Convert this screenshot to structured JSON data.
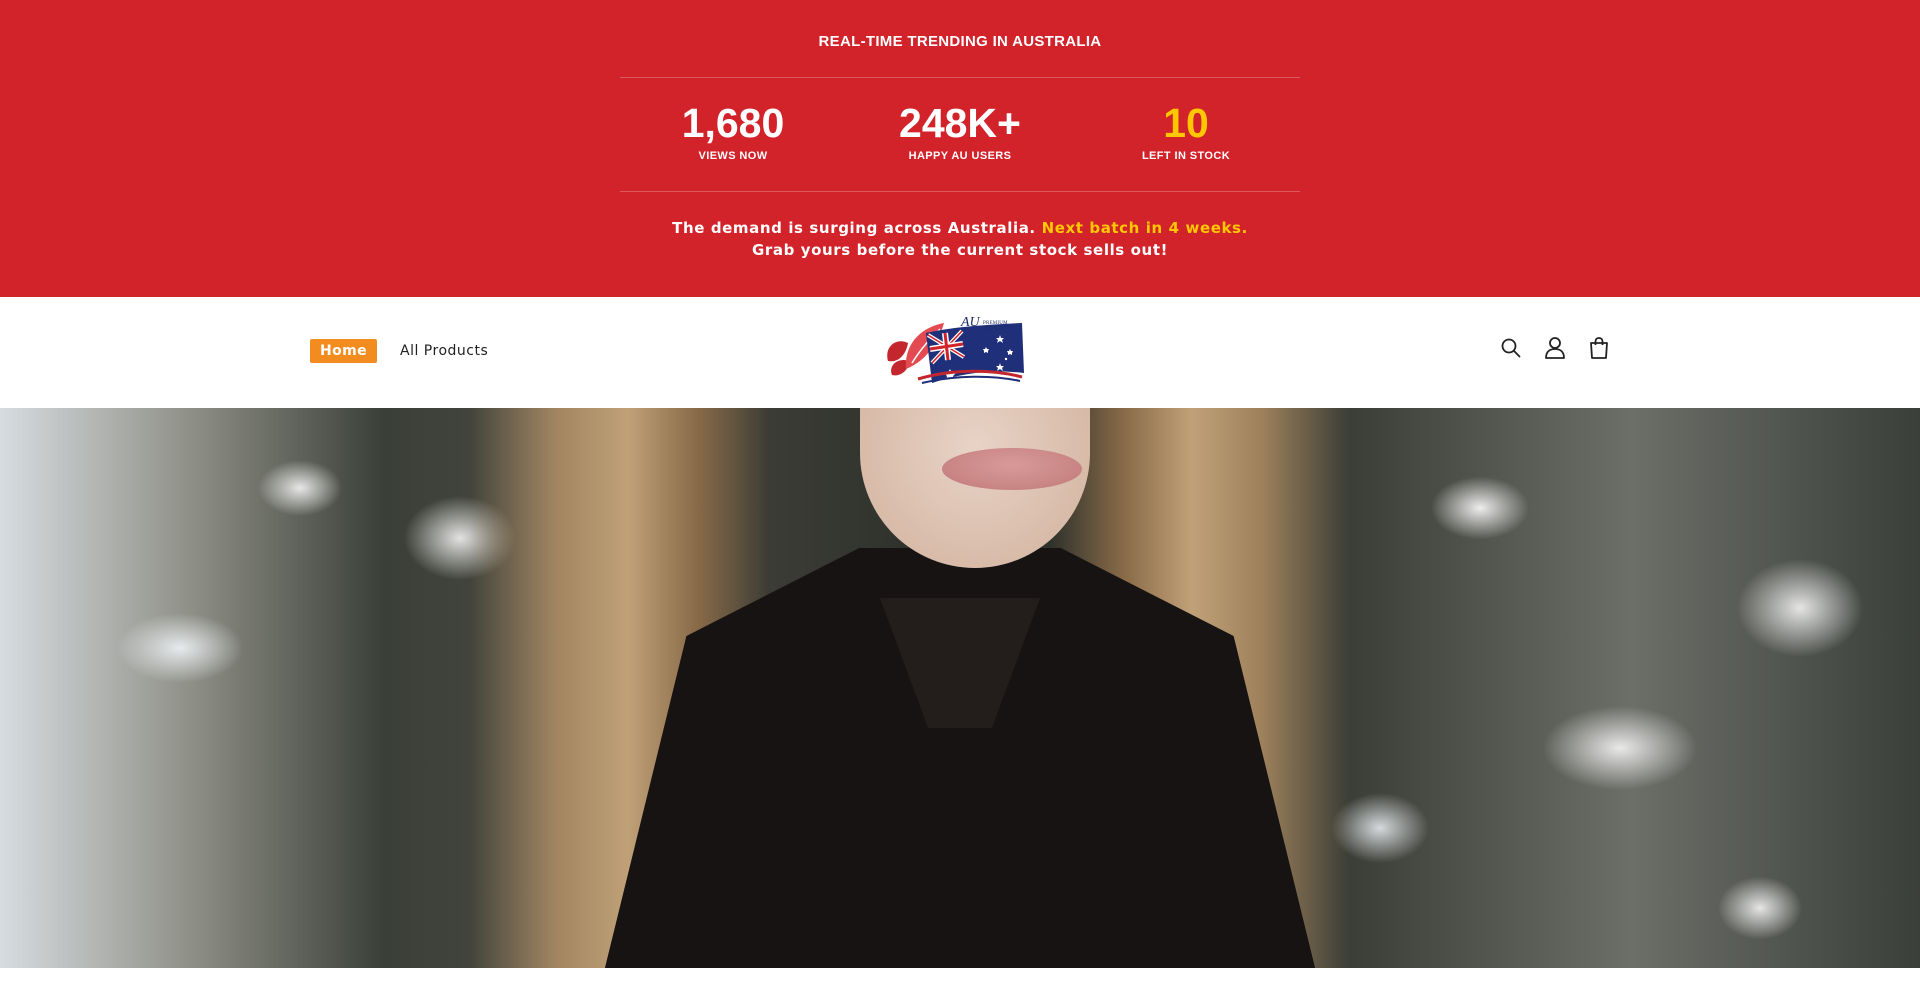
{
  "promo": {
    "headline": "REAL-TIME TRENDING IN AUSTRALIA",
    "headline_glyph_left": "",
    "headline_glyph_right": "",
    "stats": [
      {
        "value": "1,680",
        "caption": "VIEWS NOW"
      },
      {
        "value": "248K+",
        "caption": "HAPPY AU USERS"
      },
      {
        "value": "10",
        "caption": "LEFT IN STOCK"
      }
    ],
    "message_line1": "The demand is surging across Australia.",
    "message_highlight": "Next batch in 4 weeks.",
    "message_line2": "Grab yours before the current stock sells out!",
    "colors": {
      "background": "#d2222a",
      "highlight": "#ffc700"
    }
  },
  "header": {
    "nav": [
      {
        "label": "Home",
        "active": true
      },
      {
        "label": "All Products",
        "active": false
      }
    ],
    "logo": {
      "text": "AU",
      "subtext": "PREMIUM PRODUCTS"
    },
    "icons": [
      "search-icon",
      "account-icon",
      "cart-icon"
    ],
    "colors": {
      "active_nav": "#f28c1f"
    }
  },
  "hero": {
    "image": "woman-in-black-coat-among-snowy-pine-branches"
  }
}
